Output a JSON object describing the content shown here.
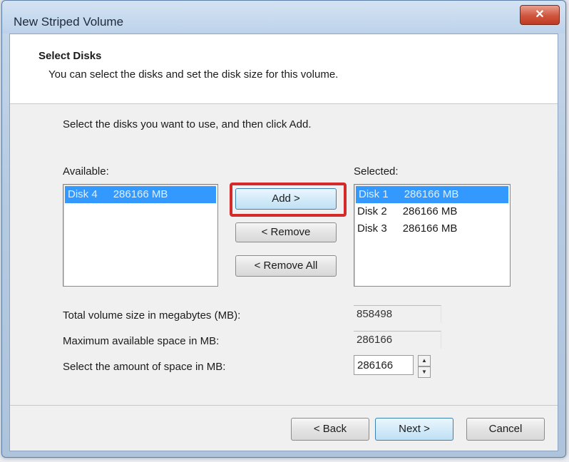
{
  "window": {
    "title": "New Striped Volume",
    "close_label": "✕"
  },
  "header": {
    "title": "Select Disks",
    "description": "You can select the disks and set the disk size for this volume."
  },
  "instruction": "Select the disks you want to use, and then click Add.",
  "available": {
    "label": "Available:",
    "items": [
      {
        "disk": "Disk 4",
        "size": "286166 MB",
        "selected": true
      }
    ]
  },
  "selected": {
    "label": "Selected:",
    "items": [
      {
        "disk": "Disk 1",
        "size": "286166 MB",
        "selected": true
      },
      {
        "disk": "Disk 2",
        "size": "286166 MB",
        "selected": false
      },
      {
        "disk": "Disk 3",
        "size": "286166 MB",
        "selected": false
      }
    ]
  },
  "buttons": {
    "add": "Add >",
    "remove": "< Remove",
    "remove_all": "< Remove All",
    "back": "< Back",
    "next": "Next >",
    "cancel": "Cancel"
  },
  "fields": {
    "total_label": "Total volume size in megabytes (MB):",
    "total_value": "858498",
    "max_label": "Maximum available space in MB:",
    "max_value": "286166",
    "amount_label": "Select the amount of space in MB:",
    "amount_value": "286166"
  }
}
